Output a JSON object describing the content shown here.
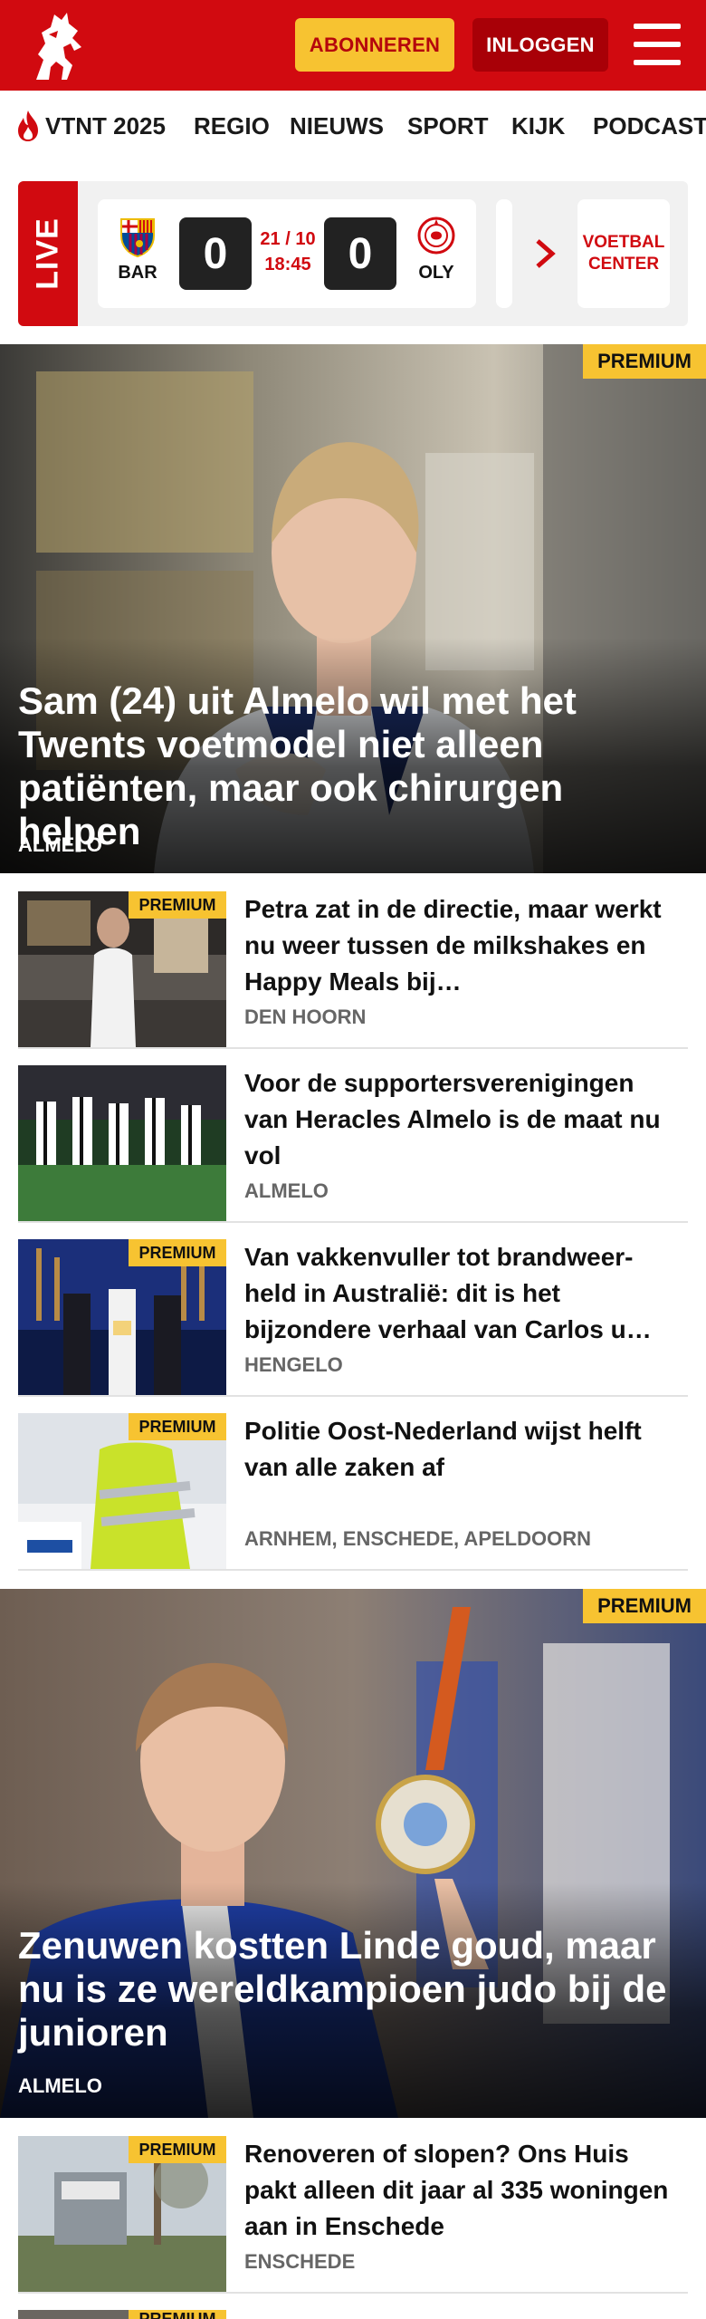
{
  "header": {
    "subscribe_label": "ABONNEREN",
    "login_label": "INLOGGEN",
    "brand_color": "#d10a10",
    "accent_color": "#f7c331"
  },
  "nav": {
    "items": [
      "VTNT 2025",
      "REGIO",
      "NIEUWS",
      "SPORT",
      "KIJK",
      "PODCAST"
    ]
  },
  "live": {
    "badge": "LIVE",
    "match": {
      "home": "BAR",
      "away": "OLY",
      "home_score": "0",
      "away_score": "0",
      "date": "21 / 10",
      "time": "18:45"
    },
    "voetbal_center": "VOETBAL CENTER"
  },
  "hero1": {
    "badge": "PREMIUM",
    "title": "Sam (24) uit Almelo wil met het Twents voetmodel niet alleen patiënten, maar ook chirurgen helpen",
    "location": "ALMELO"
  },
  "articles": [
    {
      "premium": "PREMIUM",
      "title": "Petra zat in de directie, maar werkt nu weer tussen de milkshakes en Happy Meals bij…",
      "location": "DEN HOORN"
    },
    {
      "premium": "",
      "title": "Voor de supportersverenigingen van Heracles Almelo is de maat nu vol",
      "location": "ALMELO"
    },
    {
      "premium": "PREMIUM",
      "title": "Van vakkenvuller tot brandweer-held in Australië: dit is het bijzondere verhaal van Carlos u…",
      "location": "HENGELO"
    },
    {
      "premium": "PREMIUM",
      "title": "Politie Oost-Nederland wijst helft van alle zaken af",
      "location": "ARNHEM, ENSCHEDE, APELDOORN"
    }
  ],
  "hero2": {
    "badge": "PREMIUM",
    "title": "Zenuwen kostten Linde goud, maar nu is ze wereldkampioen judo bij de junioren",
    "location": "ALMELO"
  },
  "articles2": [
    {
      "premium": "PREMIUM",
      "title": "Renoveren of slopen? Ons Huis pakt alleen dit jaar al 335 woningen aan in Enschede",
      "location": "ENSCHEDE"
    },
    {
      "premium": "PREMIUM"
    }
  ]
}
